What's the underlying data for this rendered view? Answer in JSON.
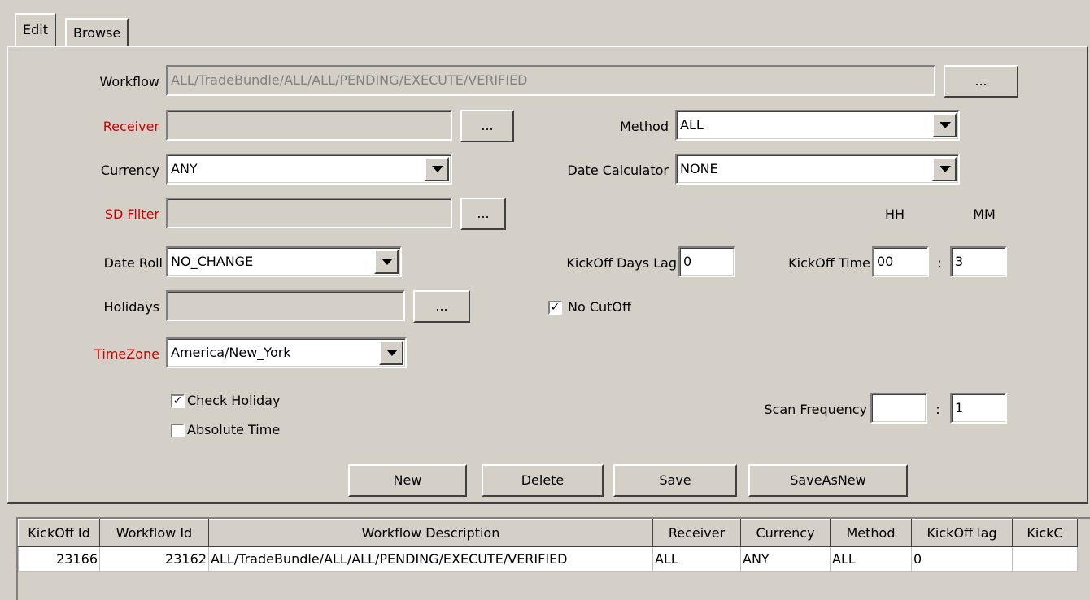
{
  "tabs": [
    {
      "label": "Edit",
      "active": true
    },
    {
      "label": "Browse",
      "active": false
    }
  ],
  "form": {
    "workflow": {
      "label": "Workflow",
      "value": "ALL/TradeBundle/ALL/ALL/PENDING/EXECUTE/VERIFIED"
    },
    "receiver": {
      "label": "Receiver",
      "value": ""
    },
    "method": {
      "label": "Method",
      "value": "ALL"
    },
    "currency": {
      "label": "Currency",
      "value": "ANY"
    },
    "date_calculator": {
      "label": "Date Calculator",
      "value": "NONE"
    },
    "sd_filter": {
      "label": "SD Filter",
      "value": ""
    },
    "hh_label": "HH",
    "mm_label": "MM",
    "date_roll": {
      "label": "Date Roll",
      "value": "NO_CHANGE"
    },
    "kickoff_days_lag": {
      "label": "KickOff Days Lag",
      "value": "0"
    },
    "kickoff_time": {
      "label": "KickOff Time",
      "hh": "00",
      "separator": ":",
      "mm": "3"
    },
    "holidays": {
      "label": "Holidays",
      "value": ""
    },
    "no_cutoff": {
      "label": "No CutOff",
      "checked": true
    },
    "timezone": {
      "label": "TimeZone",
      "value": "America/New_York"
    },
    "check_holiday": {
      "label": "Check Holiday",
      "checked": true
    },
    "absolute_time": {
      "label": "Absolute Time",
      "checked": false
    },
    "scan_frequency": {
      "label": "Scan Frequency",
      "hh": "",
      "separator": ":",
      "mm": "1"
    },
    "browse_label": "..."
  },
  "buttons": {
    "new": "New",
    "delete": "Delete",
    "save": "Save",
    "save_as_new": "SaveAsNew"
  },
  "table": {
    "columns": [
      "KickOff Id",
      "Workflow Id",
      "Workflow Description",
      "Receiver",
      "Currency",
      "Method",
      "KickOff lag",
      "KickC"
    ],
    "rows": [
      [
        "23166",
        "23162",
        "ALL/TradeBundle/ALL/ALL/PENDING/EXECUTE/VERIFIED",
        "ALL",
        "ANY",
        "ALL",
        "0",
        ""
      ]
    ]
  },
  "colors": {
    "background": "#d4d0c8",
    "required_label": "#cc0000",
    "disabled_text": "#808080"
  },
  "icons": {
    "dropdown": "chevron-down-icon",
    "checkbox": "check-icon"
  }
}
